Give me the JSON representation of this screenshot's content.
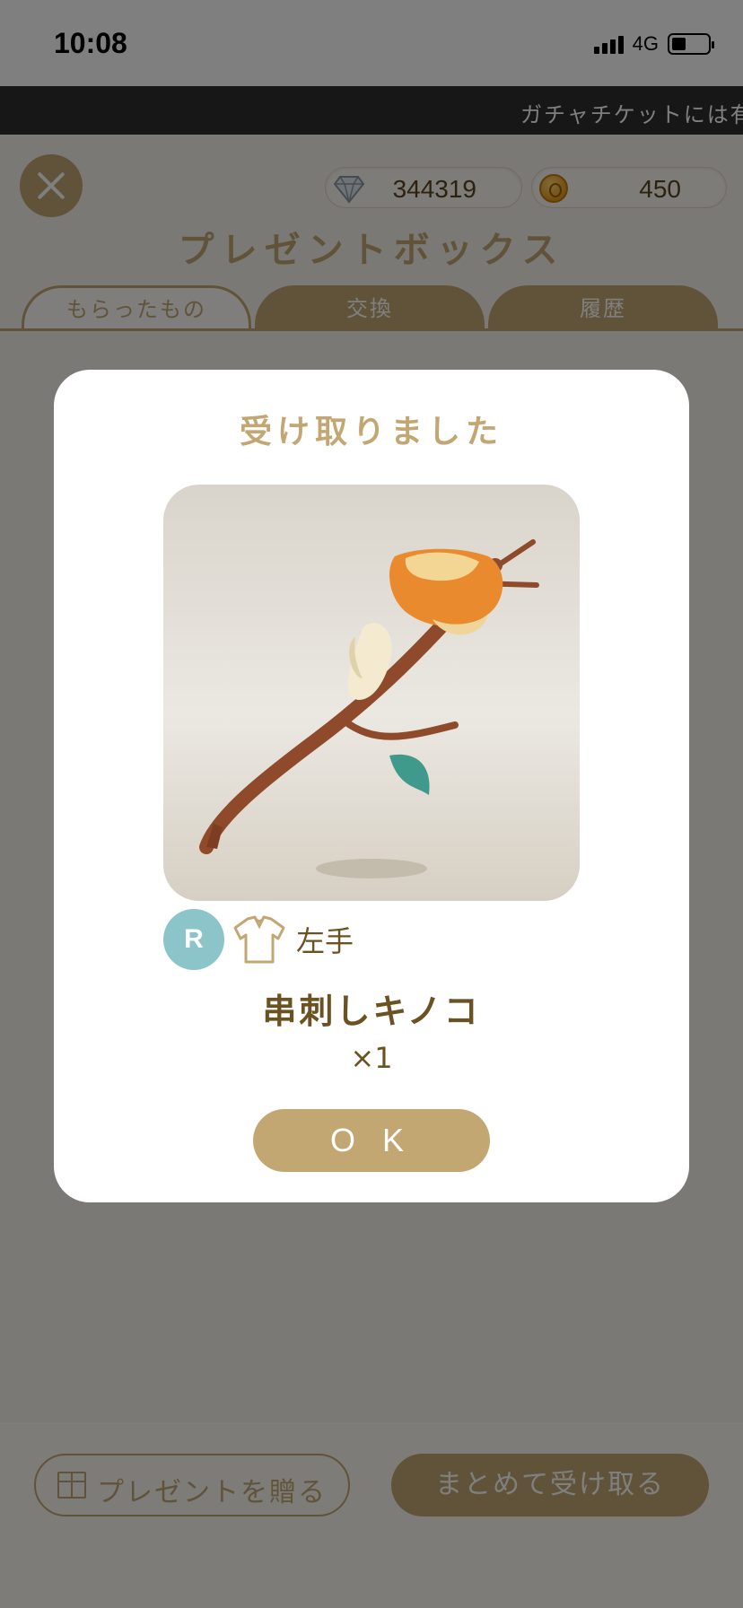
{
  "status_bar": {
    "time": "10:08",
    "network": "4G",
    "battery_level": 0.4
  },
  "ticker": {
    "text": "ガチャチケットには有"
  },
  "header": {
    "title": "プレゼントボックス",
    "close_icon": "close-icon",
    "gems": "344319",
    "coins": "450"
  },
  "tabs": [
    {
      "label": "もらったもの",
      "active": true
    },
    {
      "label": "交換",
      "active": false
    },
    {
      "label": "履歴",
      "active": false
    }
  ],
  "footer": {
    "gift_label": "プレゼントを贈る",
    "receive_all_label": "まとめて受け取る"
  },
  "modal": {
    "title": "受け取りました",
    "rarity": "R",
    "slot_icon": "shirt-icon",
    "slot": "左手",
    "item_name": "串刺しキノコ",
    "quantity": "×1",
    "ok_label": "O K"
  },
  "colors": {
    "accent": "#c3a773",
    "text": "#6b5222",
    "rarity": "#8cc5c9",
    "overlay": "rgba(0,0,0,0.5)"
  }
}
